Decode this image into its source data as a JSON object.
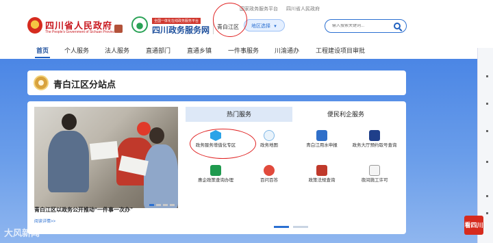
{
  "top_links": [
    "国家政务服务平台",
    "四川省人民政府"
  ],
  "header": {
    "province_name": "四川省人民政府",
    "province_en": "The People's Government of Sichuan Province",
    "service_tag": "全国一体化在线政务服务平台",
    "service_name": "四川政务服务网",
    "district": "青白江区",
    "region_button": "地区选择",
    "search_placeholder": "输入搜索关键词..."
  },
  "nav": [
    "首页",
    "个人服务",
    "法人服务",
    "直通部门",
    "直通乡镇",
    "一件事服务",
    "川渝通办",
    "工程建设项目审批"
  ],
  "section_title": "青白江区分站点",
  "news": {
    "caption": "青白江区以政务公开推动“一件事一次办”",
    "more": "阅读详情>>"
  },
  "tabs": {
    "hot": "热门服务",
    "convenient": "便民利企服务"
  },
  "services": [
    {
      "label": "政务服务增值化专区",
      "icon": "cube-icon"
    },
    {
      "label": "政务地图",
      "icon": "map-pin-icon"
    },
    {
      "label": "青白江用水申报",
      "icon": "water-report-icon"
    },
    {
      "label": "政务大厅预约取号查询",
      "icon": "queue-ticket-icon"
    },
    {
      "label": "惠企政策查询办理",
      "icon": "policy-icon"
    },
    {
      "label": "百问百答",
      "icon": "qa-icon"
    },
    {
      "label": "政策法规查询",
      "icon": "law-book-icon"
    },
    {
      "label": "夜间施工许可",
      "icon": "night-construction-icon"
    }
  ],
  "watermark": "大风新闻",
  "watermark_logo": "看四川",
  "colors": {
    "brand_blue": "#1d4f9c",
    "accent_red": "#c8161d",
    "bg_blue": "#4b86e5"
  }
}
